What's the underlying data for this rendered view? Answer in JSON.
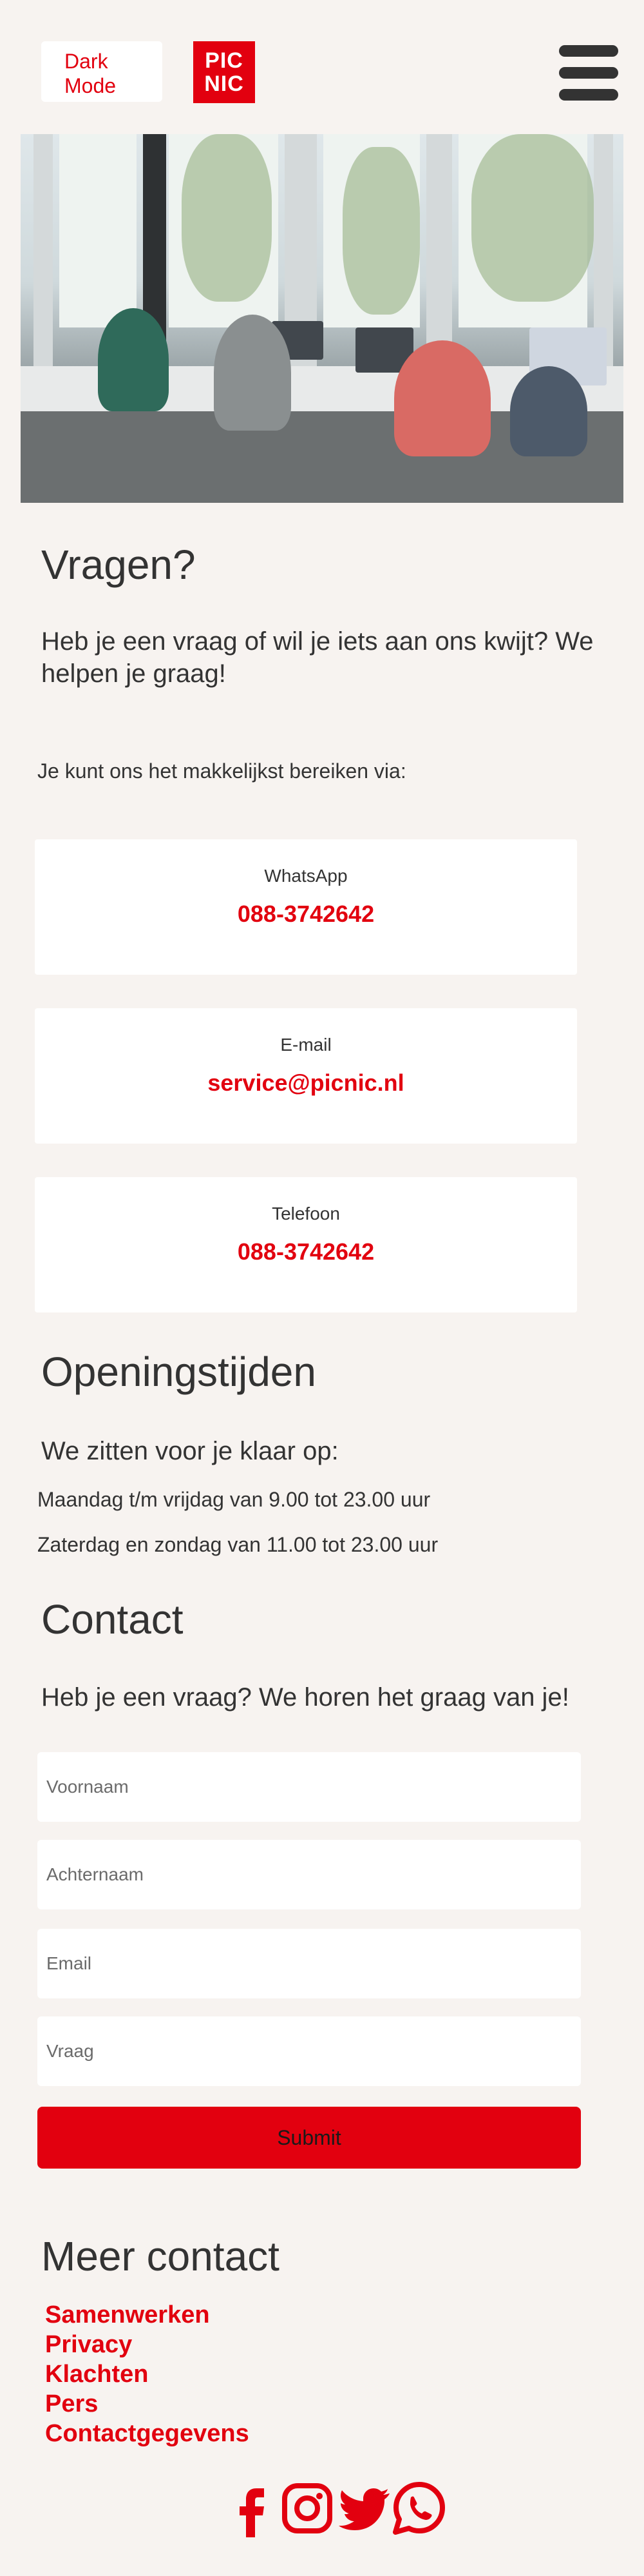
{
  "header": {
    "dark_mode_label": "Dark Mode",
    "logo_text_line1": "PIC",
    "logo_text_line2": "NIC"
  },
  "hero": {
    "icon": "office-photo"
  },
  "questions": {
    "title": "Vragen?",
    "lead": "Heb je een vraag of wil je iets aan ons kwijt? We helpen je graag!",
    "reach_text": "Je kunt ons het makkelijkst bereiken via:",
    "channels": [
      {
        "label": "WhatsApp",
        "value": "088-3742642"
      },
      {
        "label": "E-mail",
        "value": "service@picnic.nl"
      },
      {
        "label": "Telefoon",
        "value": "088-3742642"
      }
    ]
  },
  "hours": {
    "title": "Openingstijden",
    "lead": "We zitten voor je klaar op:",
    "weekdays": "Maandag t/m vrijdag van 9.00 tot 23.00 uur",
    "weekend": "Zaterdag en zondag van 11.00 tot 23.00 uur"
  },
  "contact": {
    "title": "Contact",
    "lead": "Heb je een vraag? We horen het graag van je!",
    "fields": {
      "first_name_placeholder": "Voornaam",
      "last_name_placeholder": "Achternaam",
      "email_placeholder": "Email",
      "question_placeholder": "Vraag"
    },
    "submit_label": "Submit"
  },
  "more_contact": {
    "title": "Meer contact",
    "links": [
      "Samenwerken",
      "Privacy",
      "Klachten",
      "Pers",
      "Contactgegevens"
    ]
  },
  "social": {
    "icons": [
      "facebook-icon",
      "instagram-icon",
      "twitter-icon",
      "whatsapp-icon"
    ],
    "color": "#e2000f"
  },
  "colors": {
    "accent": "#e2000f",
    "background": "#f7f3f0",
    "text": "#333333"
  }
}
